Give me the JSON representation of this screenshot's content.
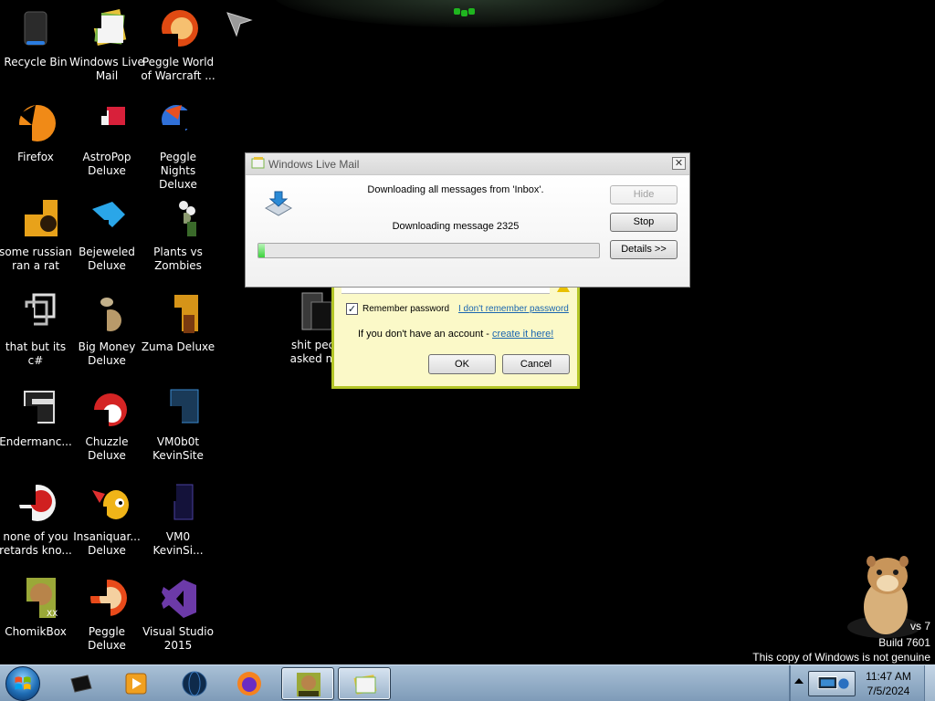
{
  "desktop": {
    "icons": [
      {
        "label": "Recycle Bin",
        "icon": "recycle-bin-icon"
      },
      {
        "label": "Windows Live Mail",
        "icon": "windows-live-mail-icon"
      },
      {
        "label": "Peggle World of Warcraft ...",
        "icon": "peggle-wow-icon"
      },
      {
        "label": "Firefox",
        "icon": "firefox-icon"
      },
      {
        "label": "AstroPop Deluxe",
        "icon": "astropop-icon"
      },
      {
        "label": "Peggle Nights Deluxe",
        "icon": "peggle-nights-icon"
      },
      {
        "label": "some russian ran a rat",
        "icon": "rat-icon"
      },
      {
        "label": "Bejeweled Deluxe",
        "icon": "bejeweled-icon"
      },
      {
        "label": "Plants vs Zombies",
        "icon": "plants-vs-zombies-icon"
      },
      {
        "label": "that but its c#",
        "icon": "shortcut-icon"
      },
      {
        "label": "Big Money Deluxe",
        "icon": "big-money-icon"
      },
      {
        "label": "Zuma Deluxe",
        "icon": "zuma-icon"
      },
      {
        "label": "Endermanc...",
        "icon": "endermanch-icon"
      },
      {
        "label": "Chuzzle Deluxe",
        "icon": "chuzzle-icon"
      },
      {
        "label": "VM0b0t KevinSite",
        "icon": "vm0b0t-icon"
      },
      {
        "label": "none of you retards kno...",
        "icon": "app-icon"
      },
      {
        "label": "Insaniquar... Deluxe",
        "icon": "insaniquarium-icon"
      },
      {
        "label": "VM0 KevinSi...",
        "icon": "vm0-icon"
      },
      {
        "label": "ChomikBox",
        "icon": "chomikbox-icon"
      },
      {
        "label": "Peggle Deluxe",
        "icon": "peggle-icon"
      },
      {
        "label": "Visual Studio 2015",
        "icon": "visual-studio-icon"
      }
    ],
    "folder_icon": {
      "label": "shit peo asked m",
      "icon": "folder-icon"
    }
  },
  "login_dialog": {
    "remember_label": "Remember password",
    "remember_checked": "✓",
    "forgot_link": "I don't remember password",
    "no_account_text": "If you don't have an account - ",
    "create_link": "create it here!",
    "ok_label": "OK",
    "cancel_label": "Cancel"
  },
  "download_dialog": {
    "title": "Windows Live Mail",
    "close_glyph": "✕",
    "status_line1": "Downloading all messages from 'Inbox'.",
    "status_line2": "Downloading message 2325",
    "progress_percent": 1,
    "hide_label": "Hide",
    "stop_label": "Stop",
    "details_label": "Details >>"
  },
  "watermark": {
    "line1": "vs 7",
    "line2": "Build 7601",
    "line3": "This copy of Windows is not genuine"
  },
  "taskbar": {
    "buttons": [
      {
        "icon": "cmd-icon"
      },
      {
        "icon": "media-player-icon"
      },
      {
        "icon": "globe-icon"
      },
      {
        "icon": "firefox-icon"
      },
      {
        "icon": "chomikbox-icon"
      },
      {
        "icon": "windows-live-mail-icon"
      }
    ],
    "clock_time": "11:47 AM",
    "clock_date": "7/5/2024"
  },
  "colors": {
    "desktop_bg": "#000000",
    "taskbar": "#94adc7",
    "progress": "#3bd33b",
    "login_bg": "#fbf9c8",
    "login_border": "#b4c628"
  }
}
